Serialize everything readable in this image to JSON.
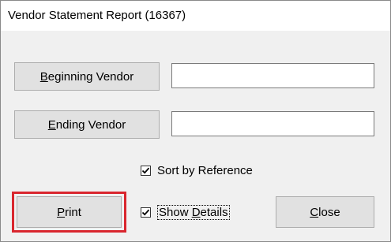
{
  "window": {
    "title": "Vendor Statement Report (16367)"
  },
  "beginning_vendor": {
    "label_mnemonic": "B",
    "label_rest": "eginning Vendor",
    "value": ""
  },
  "ending_vendor": {
    "label_mnemonic": "E",
    "label_rest": "nding Vendor",
    "value": ""
  },
  "sort_by_reference": {
    "label": "Sort by Reference",
    "checked": true
  },
  "show_details": {
    "label_before": "Show ",
    "label_mnemonic": "D",
    "label_after": "etails",
    "checked": true
  },
  "print_button": {
    "label_mnemonic": "P",
    "label_rest": "rint"
  },
  "close_button": {
    "label_mnemonic": "C",
    "label_rest": "lose"
  },
  "highlight": {
    "color": "#d9262e",
    "target": "print_button"
  }
}
